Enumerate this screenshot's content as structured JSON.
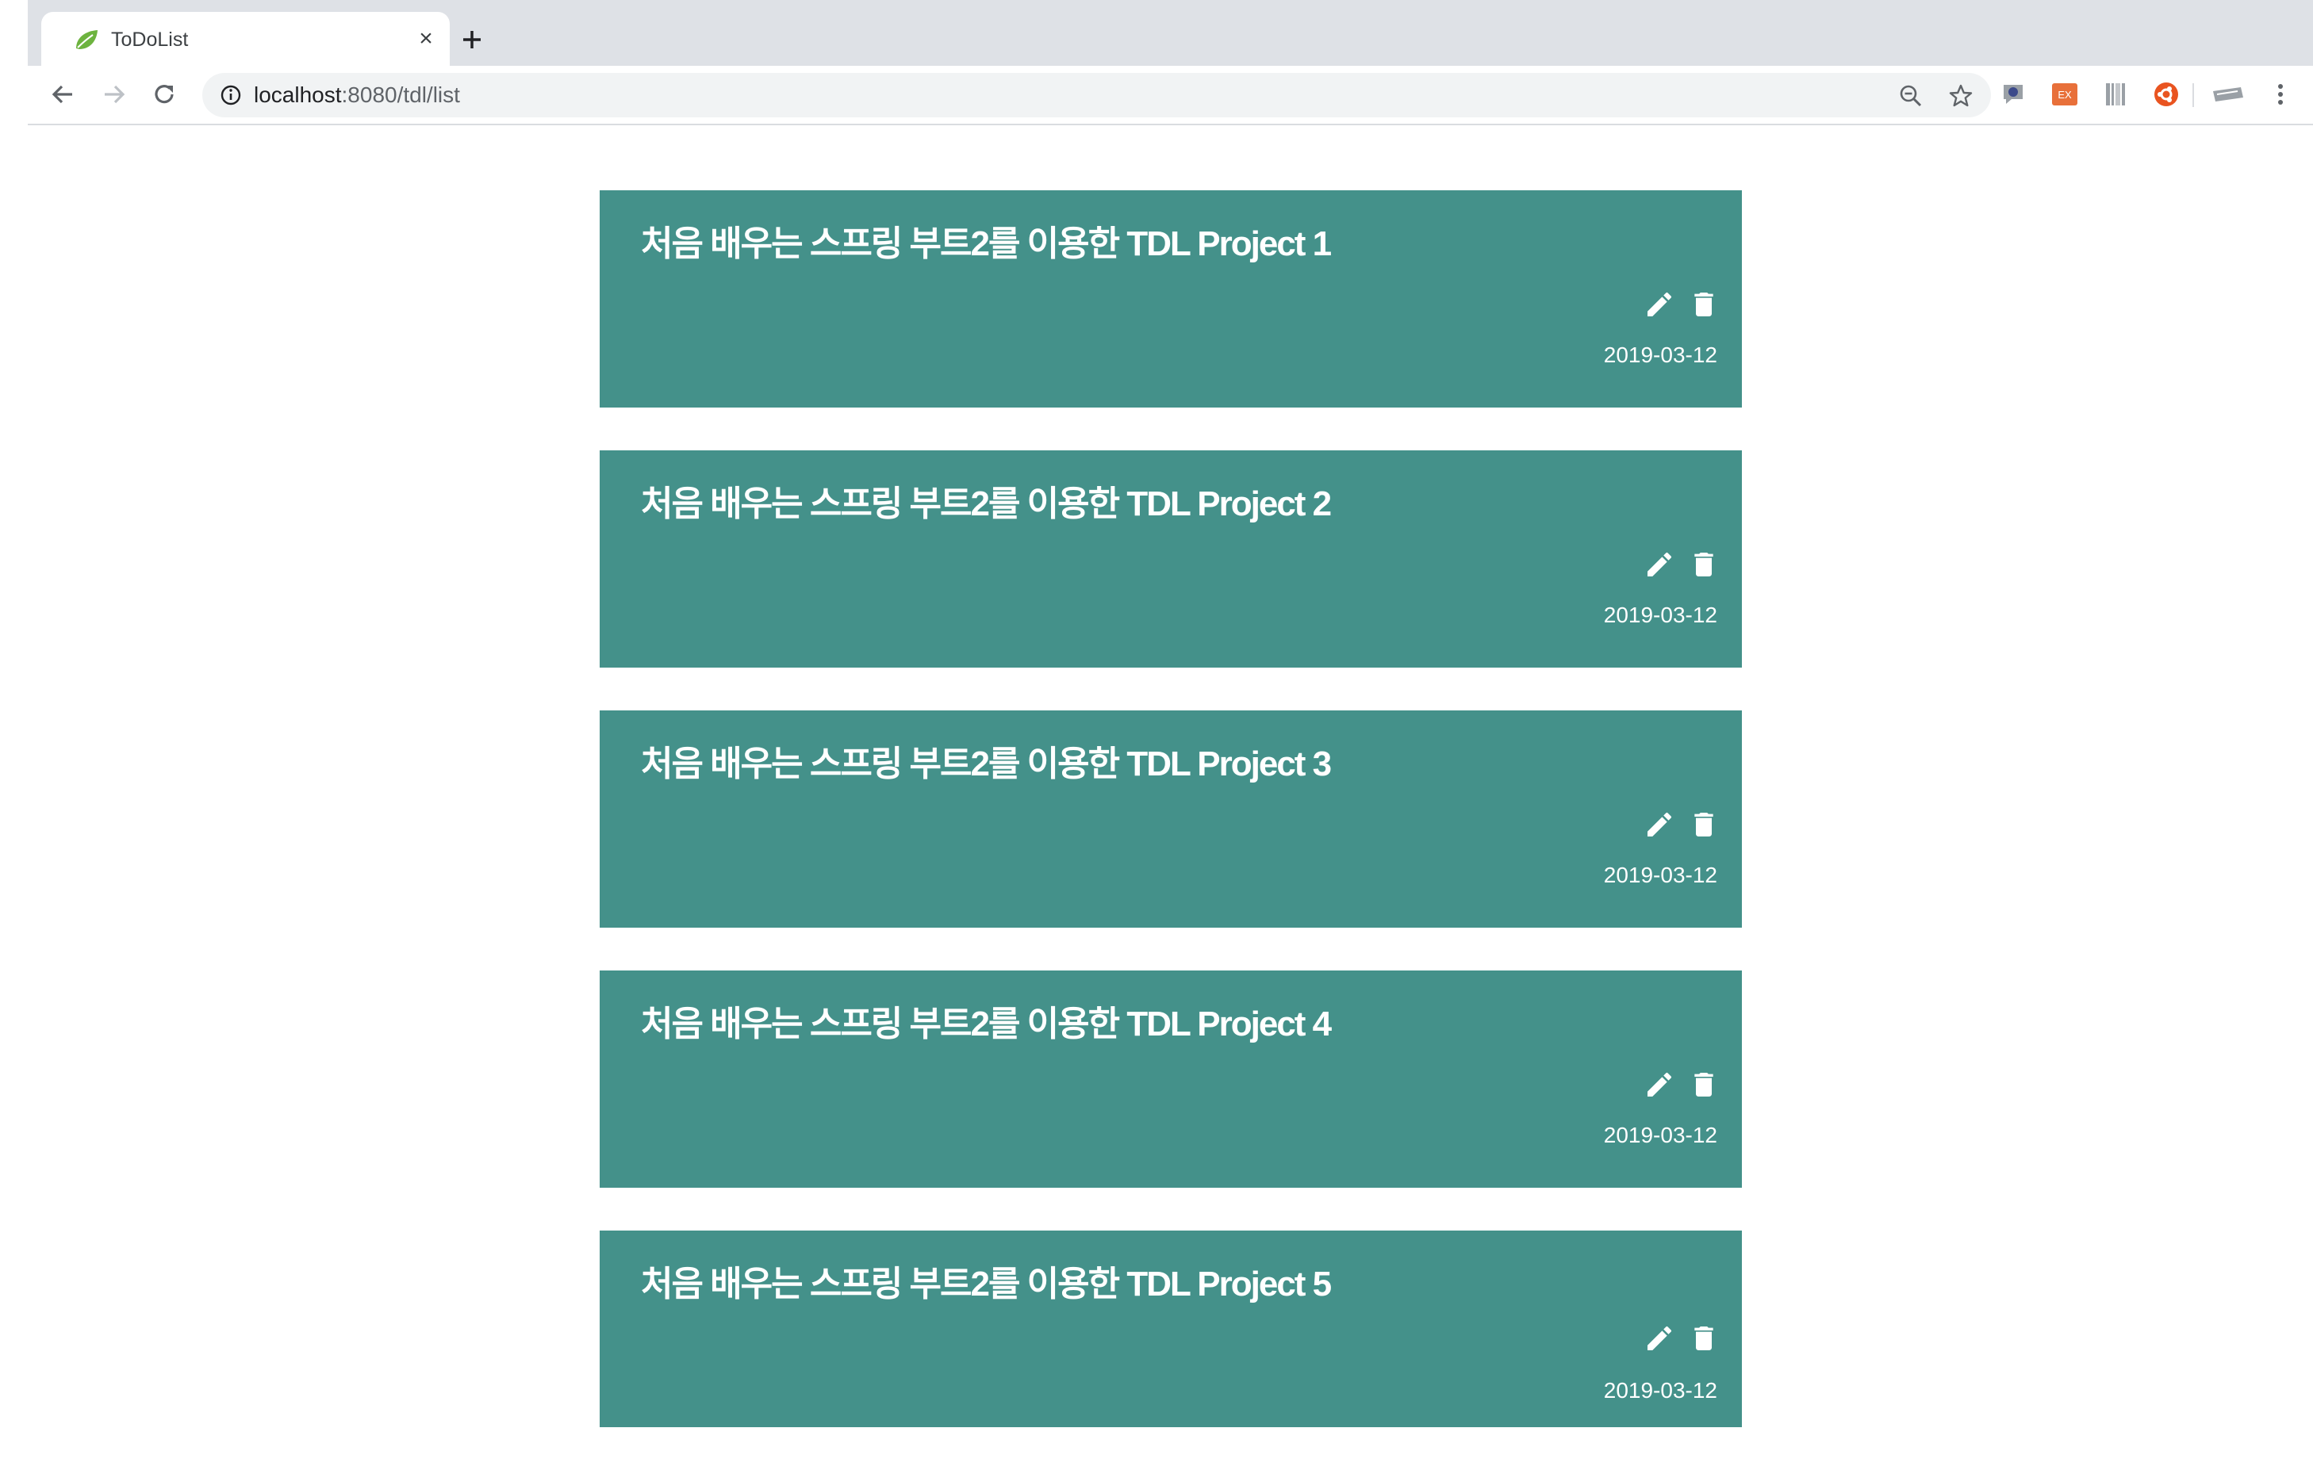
{
  "browser": {
    "tab": {
      "title": "ToDoList",
      "close_glyph": "×"
    },
    "address_bar": {
      "host": "localhost",
      "rest": ":8080/tdl/list"
    },
    "extensions": [
      "chat-extension-icon",
      "ex-extension-icon",
      "barcode-extension-icon",
      "ubuntu-extension-icon",
      "keyboard-extension-icon"
    ]
  },
  "todos": [
    {
      "title": "처음 배우는 스프링 부트2를 이용한 TDL Project 1",
      "date": "2019-03-12"
    },
    {
      "title": "처음 배우는 스프링 부트2를 이용한 TDL Project 2",
      "date": "2019-03-12"
    },
    {
      "title": "처음 배우는 스프링 부트2를 이용한 TDL Project 3",
      "date": "2019-03-12"
    },
    {
      "title": "처음 배우는 스프링 부트2를 이용한 TDL Project 4",
      "date": "2019-03-12"
    },
    {
      "title": "처음 배우는 스프링 부트2를 이용한 TDL Project 5",
      "date": "2019-03-12"
    }
  ],
  "colors": {
    "card_background": "#44918a",
    "card_text": "#ffffff",
    "tabstrip": "#dee1e6",
    "omnibox": "#f1f3f4"
  }
}
